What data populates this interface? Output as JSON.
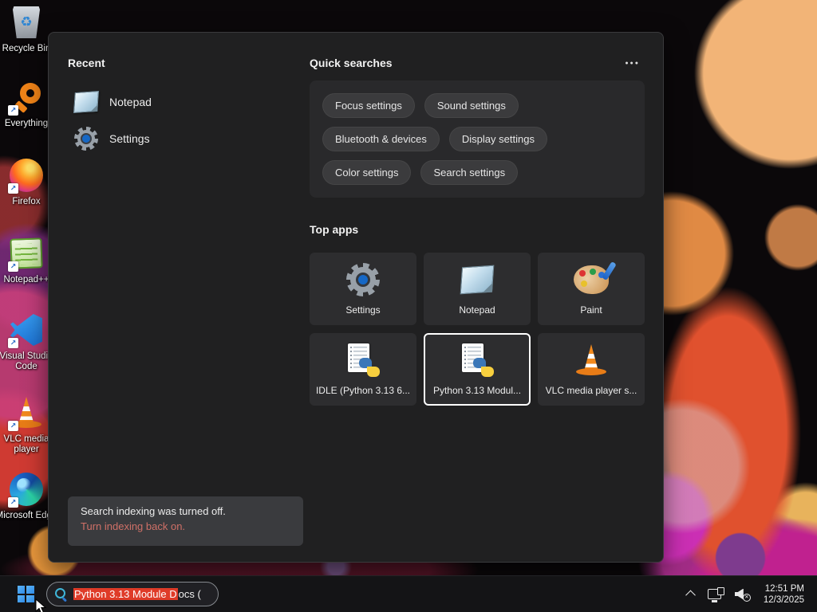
{
  "desktop": {
    "icons": [
      {
        "name": "recycle-bin",
        "label": "Recycle Bin"
      },
      {
        "name": "everything",
        "label": "Everything"
      },
      {
        "name": "firefox",
        "label": "Firefox"
      },
      {
        "name": "notepad-plus-plus",
        "label": "Notepad++"
      },
      {
        "name": "visual-studio-code",
        "label": "Visual Studio Code"
      },
      {
        "name": "vlc-media-player",
        "label": "VLC media player"
      },
      {
        "name": "microsoft-edge",
        "label": "Microsoft Edge"
      }
    ],
    "recycle_symbol": "♻",
    "shortcut_arrow": "↗"
  },
  "panel": {
    "recent": {
      "title": "Recent",
      "items": [
        {
          "icon": "notepad-icon",
          "label": "Notepad"
        },
        {
          "icon": "settings-gear-icon",
          "label": "Settings"
        }
      ]
    },
    "quick": {
      "title": "Quick searches",
      "more_label": "●●●",
      "rows": [
        [
          "Focus settings",
          "Sound settings"
        ],
        [
          "Bluetooth & devices",
          "Display settings"
        ],
        [
          "Color settings",
          "Search settings"
        ]
      ]
    },
    "top_apps": {
      "title": "Top apps",
      "tiles": [
        {
          "icon": "settings-gear-icon",
          "label": "Settings",
          "selected": false
        },
        {
          "icon": "notepad-icon",
          "label": "Notepad",
          "selected": false
        },
        {
          "icon": "paint-palette-icon",
          "label": "Paint",
          "selected": false
        },
        {
          "icon": "python-doc-icon",
          "label": "IDLE (Python 3.13 6...",
          "selected": false
        },
        {
          "icon": "python-doc-icon",
          "label": "Python 3.13 Modul...",
          "selected": true
        },
        {
          "icon": "vlc-cone-icon",
          "label": "VLC media player s...",
          "selected": false
        }
      ]
    },
    "notice": {
      "message": "Search indexing was turned off.",
      "action": "Turn indexing back on."
    }
  },
  "taskbar": {
    "search_box": {
      "highlighted_text": "Python 3.13 Module D",
      "trailing_text": "ocs (",
      "icon": "search-magnifier-icon"
    },
    "tray": {
      "hidden_icons": "chevron-up-icon",
      "network": "network-icon",
      "volume": "volume-muted-icon",
      "time": "12:51 PM",
      "date": "12/3/2025"
    }
  },
  "colors": {
    "selection_highlight": "#df3b28",
    "notice_link": "#cf7067",
    "selected_tile_border": "#ffffff",
    "panel_background": "#202021",
    "taskbar_background": "#141416"
  }
}
